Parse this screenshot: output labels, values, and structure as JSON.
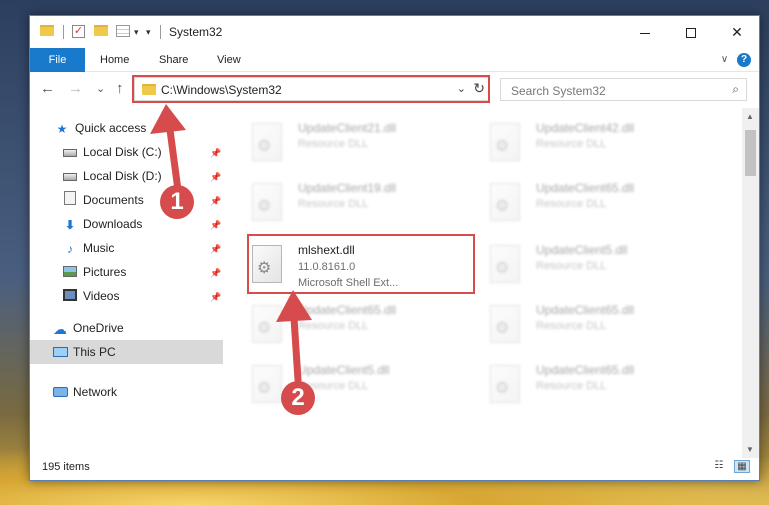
{
  "window": {
    "title": "System32",
    "quick_access_dropdown": "▾",
    "minimize": "",
    "maximize": "",
    "close": "✕"
  },
  "ribbon": {
    "file_tab": "File",
    "tabs": [
      "Home",
      "Share",
      "View"
    ],
    "expand_glyph": "∨",
    "help_glyph": "?"
  },
  "navigation": {
    "back": "←",
    "forward": "→",
    "recent": "⌄",
    "up": "↑",
    "address": "C:\\Windows\\System32",
    "address_dropdown": "⌄",
    "refresh": "↻",
    "search_placeholder": "Search System32",
    "search_glyph": "⌕"
  },
  "sidebar": {
    "quick_access": "Quick access",
    "items": [
      {
        "label": "Local Disk (C:)",
        "pinned": true
      },
      {
        "label": "Local Disk (D:)",
        "pinned": true
      },
      {
        "label": "Documents",
        "pinned": true
      },
      {
        "label": "Downloads",
        "pinned": true
      },
      {
        "label": "Music",
        "pinned": true
      },
      {
        "label": "Pictures",
        "pinned": true
      },
      {
        "label": "Videos",
        "pinned": true
      }
    ],
    "onedrive": "OneDrive",
    "this_pc": "This PC",
    "network": "Network",
    "pin_glyph": "📌"
  },
  "files": [
    {
      "name": "UpdateClient21.dll",
      "line2": "Resource DLL"
    },
    {
      "name": "UpdateClient42.dll",
      "line2": "Resource DLL"
    },
    {
      "name": "UpdateClient19.dll",
      "line2": "Resource DLL"
    },
    {
      "name": "UpdateClient65.dll",
      "line2": "Resource DLL"
    },
    {
      "name": "mlshext.dll",
      "line2": "11.0.8161.0",
      "line3": "Microsoft Shell Ext..."
    },
    {
      "name": "UpdateClient5.dll",
      "line2": "Resource DLL"
    },
    {
      "name": "UpdateClient65.dll",
      "line2": "Resource DLL"
    },
    {
      "name": "UpdateClient65.dll",
      "line2": "Resource DLL"
    },
    {
      "name": "UpdateClient5.dll",
      "line2": "Resource DLL"
    },
    {
      "name": "UpdateClient65.dll",
      "line2": "Resource DLL"
    }
  ],
  "status": {
    "item_count": "195 items",
    "details_view_glyph": "☷",
    "tiles_view_glyph": "▦"
  },
  "annotations": {
    "step1": "1",
    "step2": "2",
    "accent_color": "#d64b4b"
  },
  "colors": {
    "ribbon_file_tab": "#1979ca",
    "selection": "#d9d9d9",
    "folder": "#f0c84a"
  }
}
